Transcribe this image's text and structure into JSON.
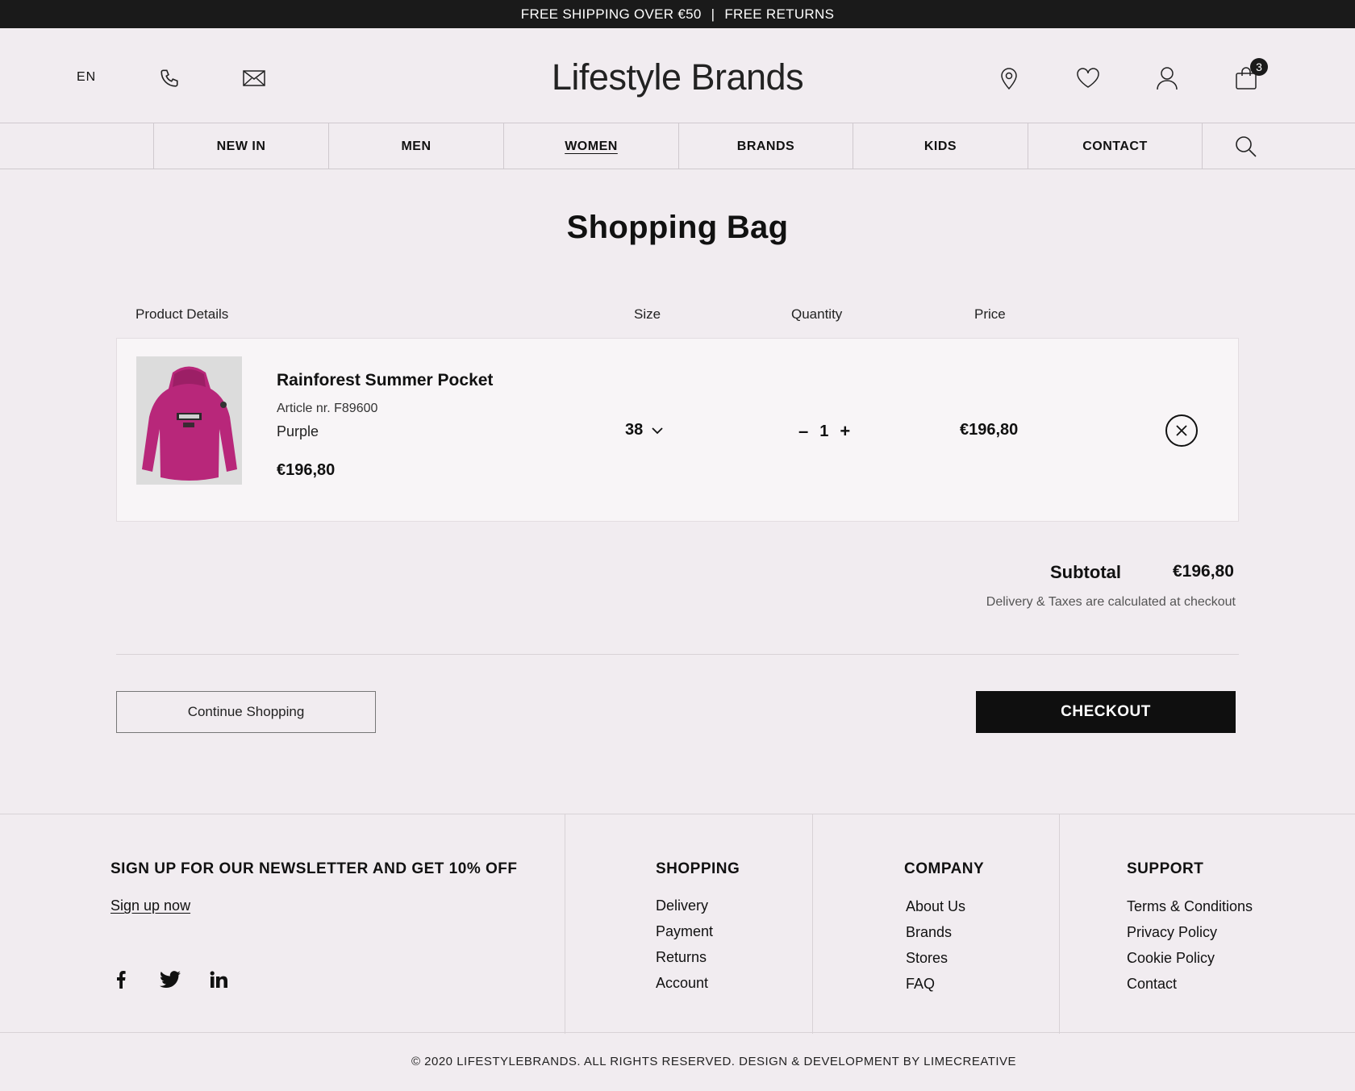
{
  "topbar": {
    "left": "FREE SHIPPING OVER €50",
    "sep": "|",
    "right": "FREE RETURNS"
  },
  "header": {
    "lang": "EN",
    "logo": "Lifestyle Brands",
    "cart_count": "3",
    "icons": [
      "phone-icon",
      "mail-icon",
      "location-icon",
      "heart-icon",
      "user-icon",
      "bag-icon"
    ]
  },
  "nav": {
    "items": [
      "NEW IN",
      "MEN",
      "WOMEN",
      "BRANDS",
      "KIDS",
      "CONTACT"
    ],
    "active": "WOMEN"
  },
  "page": {
    "title": "Shopping Bag"
  },
  "columns": {
    "product": "Product Details",
    "size": "Size",
    "quantity": "Quantity",
    "price": "Price"
  },
  "item": {
    "name": "Rainforest Summer Pocket",
    "article": "Article nr. F89600",
    "color": "Purple",
    "unit_price": "€196,80",
    "size": "38",
    "quantity": "1",
    "minus": "–",
    "plus": "+",
    "line_price": "€196,80"
  },
  "summary": {
    "subtotal_label": "Subtotal",
    "subtotal_value": "€196,80",
    "note": "Delivery & Taxes are calculated at checkout"
  },
  "actions": {
    "continue": "Continue Shopping",
    "checkout": "CHECKOUT"
  },
  "footer": {
    "newsletter_title": "SIGN UP FOR OUR NEWSLETTER AND GET 10% OFF",
    "signup": "Sign up now",
    "shopping": {
      "title": "SHOPPING",
      "links": [
        "Delivery",
        "Payment",
        "Returns",
        "Account"
      ]
    },
    "company": {
      "title": "COMPANY",
      "links": [
        "About Us",
        "Brands",
        "Stores",
        "FAQ"
      ]
    },
    "support": {
      "title": "SUPPORT",
      "links": [
        "Terms & Conditions",
        "Privacy Policy",
        "Cookie Policy",
        "Contact"
      ]
    },
    "copyright": "© 2020 LIFESTYLEBRANDS. ALL RIGHTS RESERVED. DESIGN & DEVELOPMENT BY LIMECREATIVE"
  },
  "colors": {
    "background": "#f1ecf0",
    "topbar": "#1a1a1a",
    "product_accent": "#b8277a",
    "checkout": "#0f0f0f"
  }
}
